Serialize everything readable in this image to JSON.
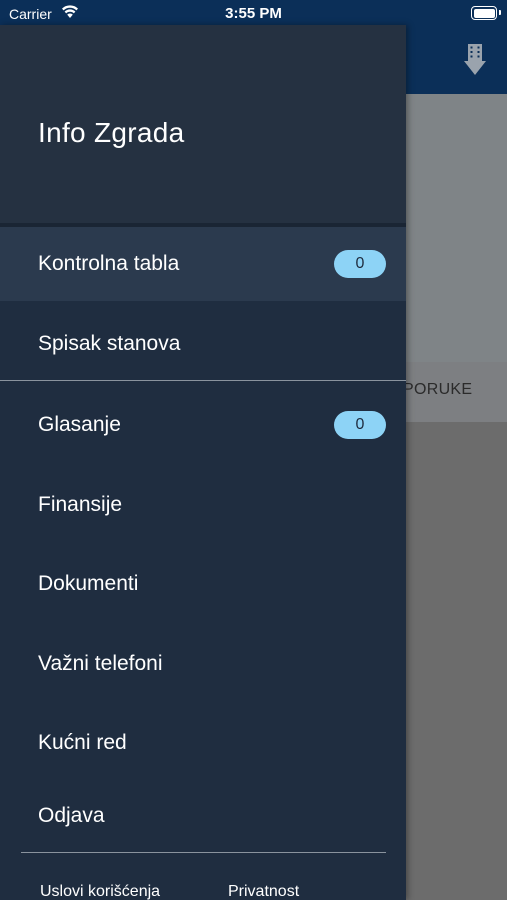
{
  "status_bar": {
    "carrier": "Carrier",
    "time": "3:55 PM",
    "wifi_icon": "wifi-icon",
    "battery_icon": "battery-icon"
  },
  "background": {
    "tab_label": "PORUKE",
    "appbar_color": "#0b2f58",
    "action_icon": "building-download-icon"
  },
  "drawer": {
    "title": "Info Zgrada",
    "items": [
      {
        "label": "Kontrolna tabla",
        "badge": "0",
        "active": true
      },
      {
        "label": "Spisak stanova"
      },
      {
        "label": "Glasanje",
        "badge": "0"
      },
      {
        "label": "Finansije"
      },
      {
        "label": "Dokumenti"
      },
      {
        "label": "Važni telefoni"
      },
      {
        "label": "Kućni red"
      },
      {
        "label": "Odjava"
      }
    ],
    "footer": {
      "terms": "Uslovi korišćenja",
      "privacy": "Privatnost"
    }
  },
  "colors": {
    "drawer_bg": "#1f2d40",
    "drawer_header_bg": "#253141",
    "active_item_bg": "#2b3a4e",
    "badge_bg": "#8dd3f6"
  }
}
